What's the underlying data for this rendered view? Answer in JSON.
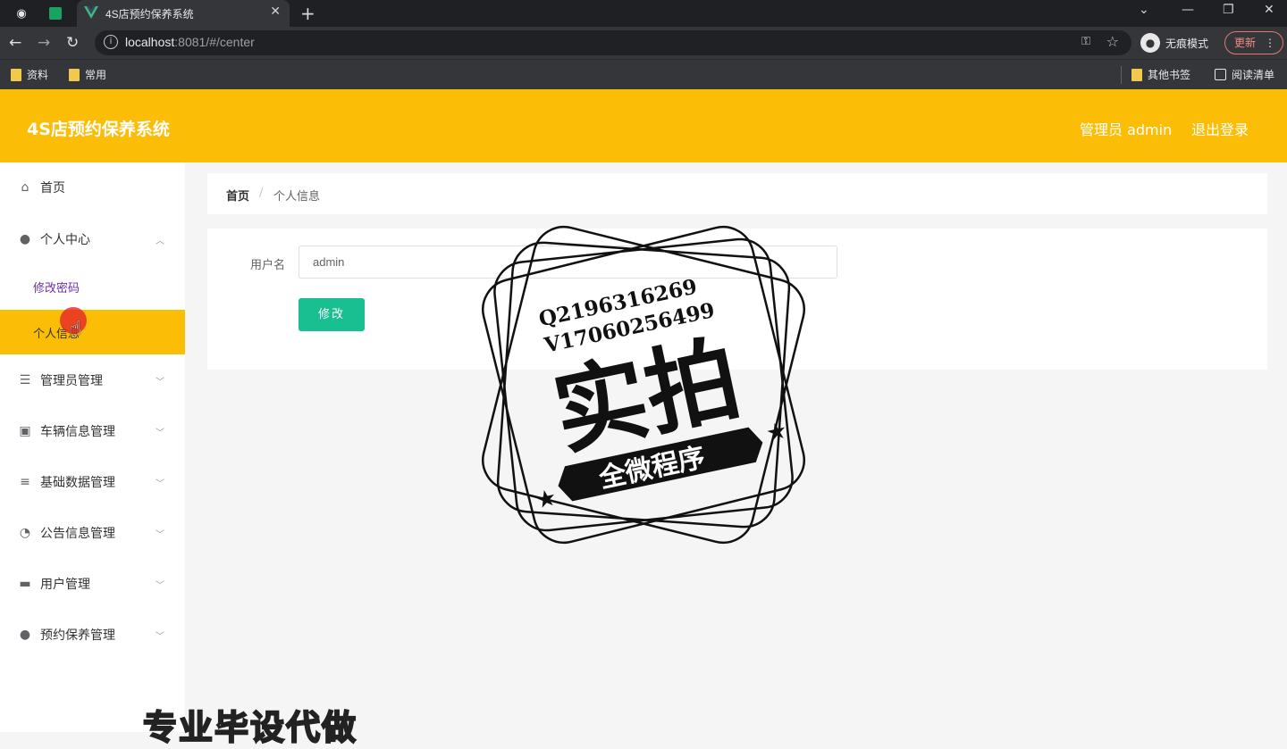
{
  "browser": {
    "tab_title": "4S店预约保养系统",
    "url_host": "localhost",
    "url_rest": ":8081/#/center",
    "incognito_label": "无痕模式",
    "update_label": "更新",
    "bookmarks": [
      "资料",
      "常用"
    ],
    "bookmarks_right": [
      "其他书签",
      "阅读清单"
    ]
  },
  "app": {
    "title": "4S店预约保养系统",
    "user_label": "管理员 admin",
    "logout_label": "退出登录",
    "accent_color": "#fcbd06"
  },
  "sidebar": {
    "items": [
      {
        "label": "首页",
        "icon": "home-icon"
      },
      {
        "label": "个人中心",
        "icon": "user-icon",
        "expanded": true,
        "children": [
          {
            "label": "修改密码"
          },
          {
            "label": "个人信息",
            "active": true
          }
        ]
      },
      {
        "label": "管理员管理",
        "icon": "list-icon"
      },
      {
        "label": "车辆信息管理",
        "icon": "clipboard-icon"
      },
      {
        "label": "基础数据管理",
        "icon": "menu-icon"
      },
      {
        "label": "公告信息管理",
        "icon": "gauge-icon"
      },
      {
        "label": "用户管理",
        "icon": "printer-icon"
      },
      {
        "label": "预约保养管理",
        "icon": "bulb-icon"
      }
    ]
  },
  "breadcrumb": {
    "home": "首页",
    "separator": "/",
    "current": "个人信息"
  },
  "form": {
    "username_label": "用户名",
    "username_value": "admin",
    "submit_label": "修改"
  },
  "watermark": {
    "qq": "Q2196316269",
    "wechat": "V17060256499",
    "big_text": "实拍",
    "ribbon": "全微程序",
    "banner": "专业毕设代做"
  }
}
